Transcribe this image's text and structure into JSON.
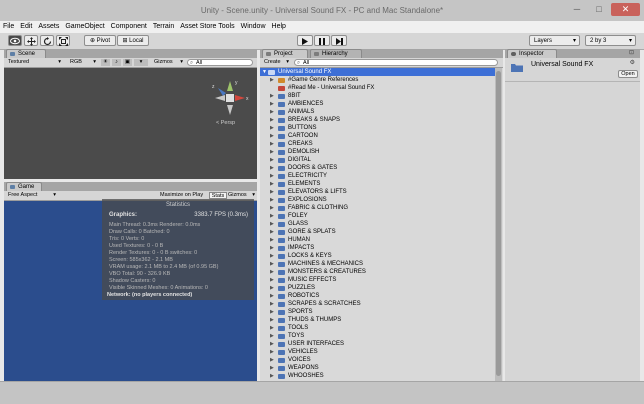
{
  "window": {
    "title": "Unity - Scene.unity - Universal Sound FX - PC and Mac Standalone*",
    "minimize": "─",
    "maximize": "□",
    "close": "✕"
  },
  "menu": [
    "File",
    "Edit",
    "Assets",
    "GameObject",
    "Component",
    "Terrain",
    "Asset Store Tools",
    "Window",
    "Help"
  ],
  "toolbar": {
    "pivot": "Pivot",
    "local": "Local",
    "layers": "Layers",
    "layout": "2 by 3"
  },
  "scene": {
    "tab": "Scene",
    "shading": "Textured",
    "render": "RGB",
    "gizmos": "Gizmos",
    "search": "All",
    "persp": "< Persp",
    "axis_x": "x",
    "axis_y": "y",
    "axis_z": "z"
  },
  "game": {
    "tab": "Game",
    "aspect": "Free Aspect",
    "maximize": "Maximize on Play",
    "stats": "Stats",
    "gizmos": "Gizmos"
  },
  "statistics": {
    "title": "Statistics",
    "graphics_label": "Graphics:",
    "fps": "3383.7 FPS (0.3ms)",
    "lines": [
      "Main Thread: 0.3ms  Renderer: 0.0ms",
      "Draw Calls: 0   Batched: 0",
      "Tris: 0     Verts: 0",
      "Used Textures: 0 - 0 B",
      "Render Textures: 0 - 0 B   switches: 0",
      "Screen: 585x362 - 2.1 MB",
      "VRAM usage: 2.1 MB to 2.4 MB (of 0.95 GB)",
      "VBO Total: 90 - 326.9 KB",
      "Shadow Casters: 0",
      "Visible Skinned Meshes: 0     Animations: 0"
    ],
    "network": "Network: (no players connected)"
  },
  "project": {
    "tab": "Project",
    "hierarchy_tab": "Hierarchy",
    "create": "Create",
    "search": "All",
    "root": "Universal Sound FX",
    "special": [
      "#Game Genre References",
      "#Read Me - Universal Sound FX"
    ],
    "folders": [
      "8BIT",
      "AMBIENCES",
      "ANIMALS",
      "BREAKS & SNAPS",
      "BUTTONS",
      "CARTOON",
      "CREAKS",
      "DEMOLISH",
      "DIGITAL",
      "DOORS & GATES",
      "ELECTRICITY",
      "ELEMENTS",
      "ELEVATORS & LIFTS",
      "EXPLOSIONS",
      "FABRIC & CLOTHING",
      "FOLEY",
      "GLASS",
      "GORE & SPLATS",
      "HUMAN",
      "IMPACTS",
      "LOCKS & KEYS",
      "MACHINES & MECHANICS",
      "MONSTERS & CREATURES",
      "MUSIC EFFECTS",
      "PUZZLES",
      "ROBOTICS",
      "SCRAPES & SCRATCHES",
      "SPORTS",
      "THUDS & THUMPS",
      "TOOLS",
      "TOYS",
      "USER INTERFACES",
      "VEHICLES",
      "VOICES",
      "WEAPONS",
      "WHOOSHES"
    ]
  },
  "inspector": {
    "tab": "Inspector",
    "object": "Universal Sound FX",
    "open": "Open"
  }
}
